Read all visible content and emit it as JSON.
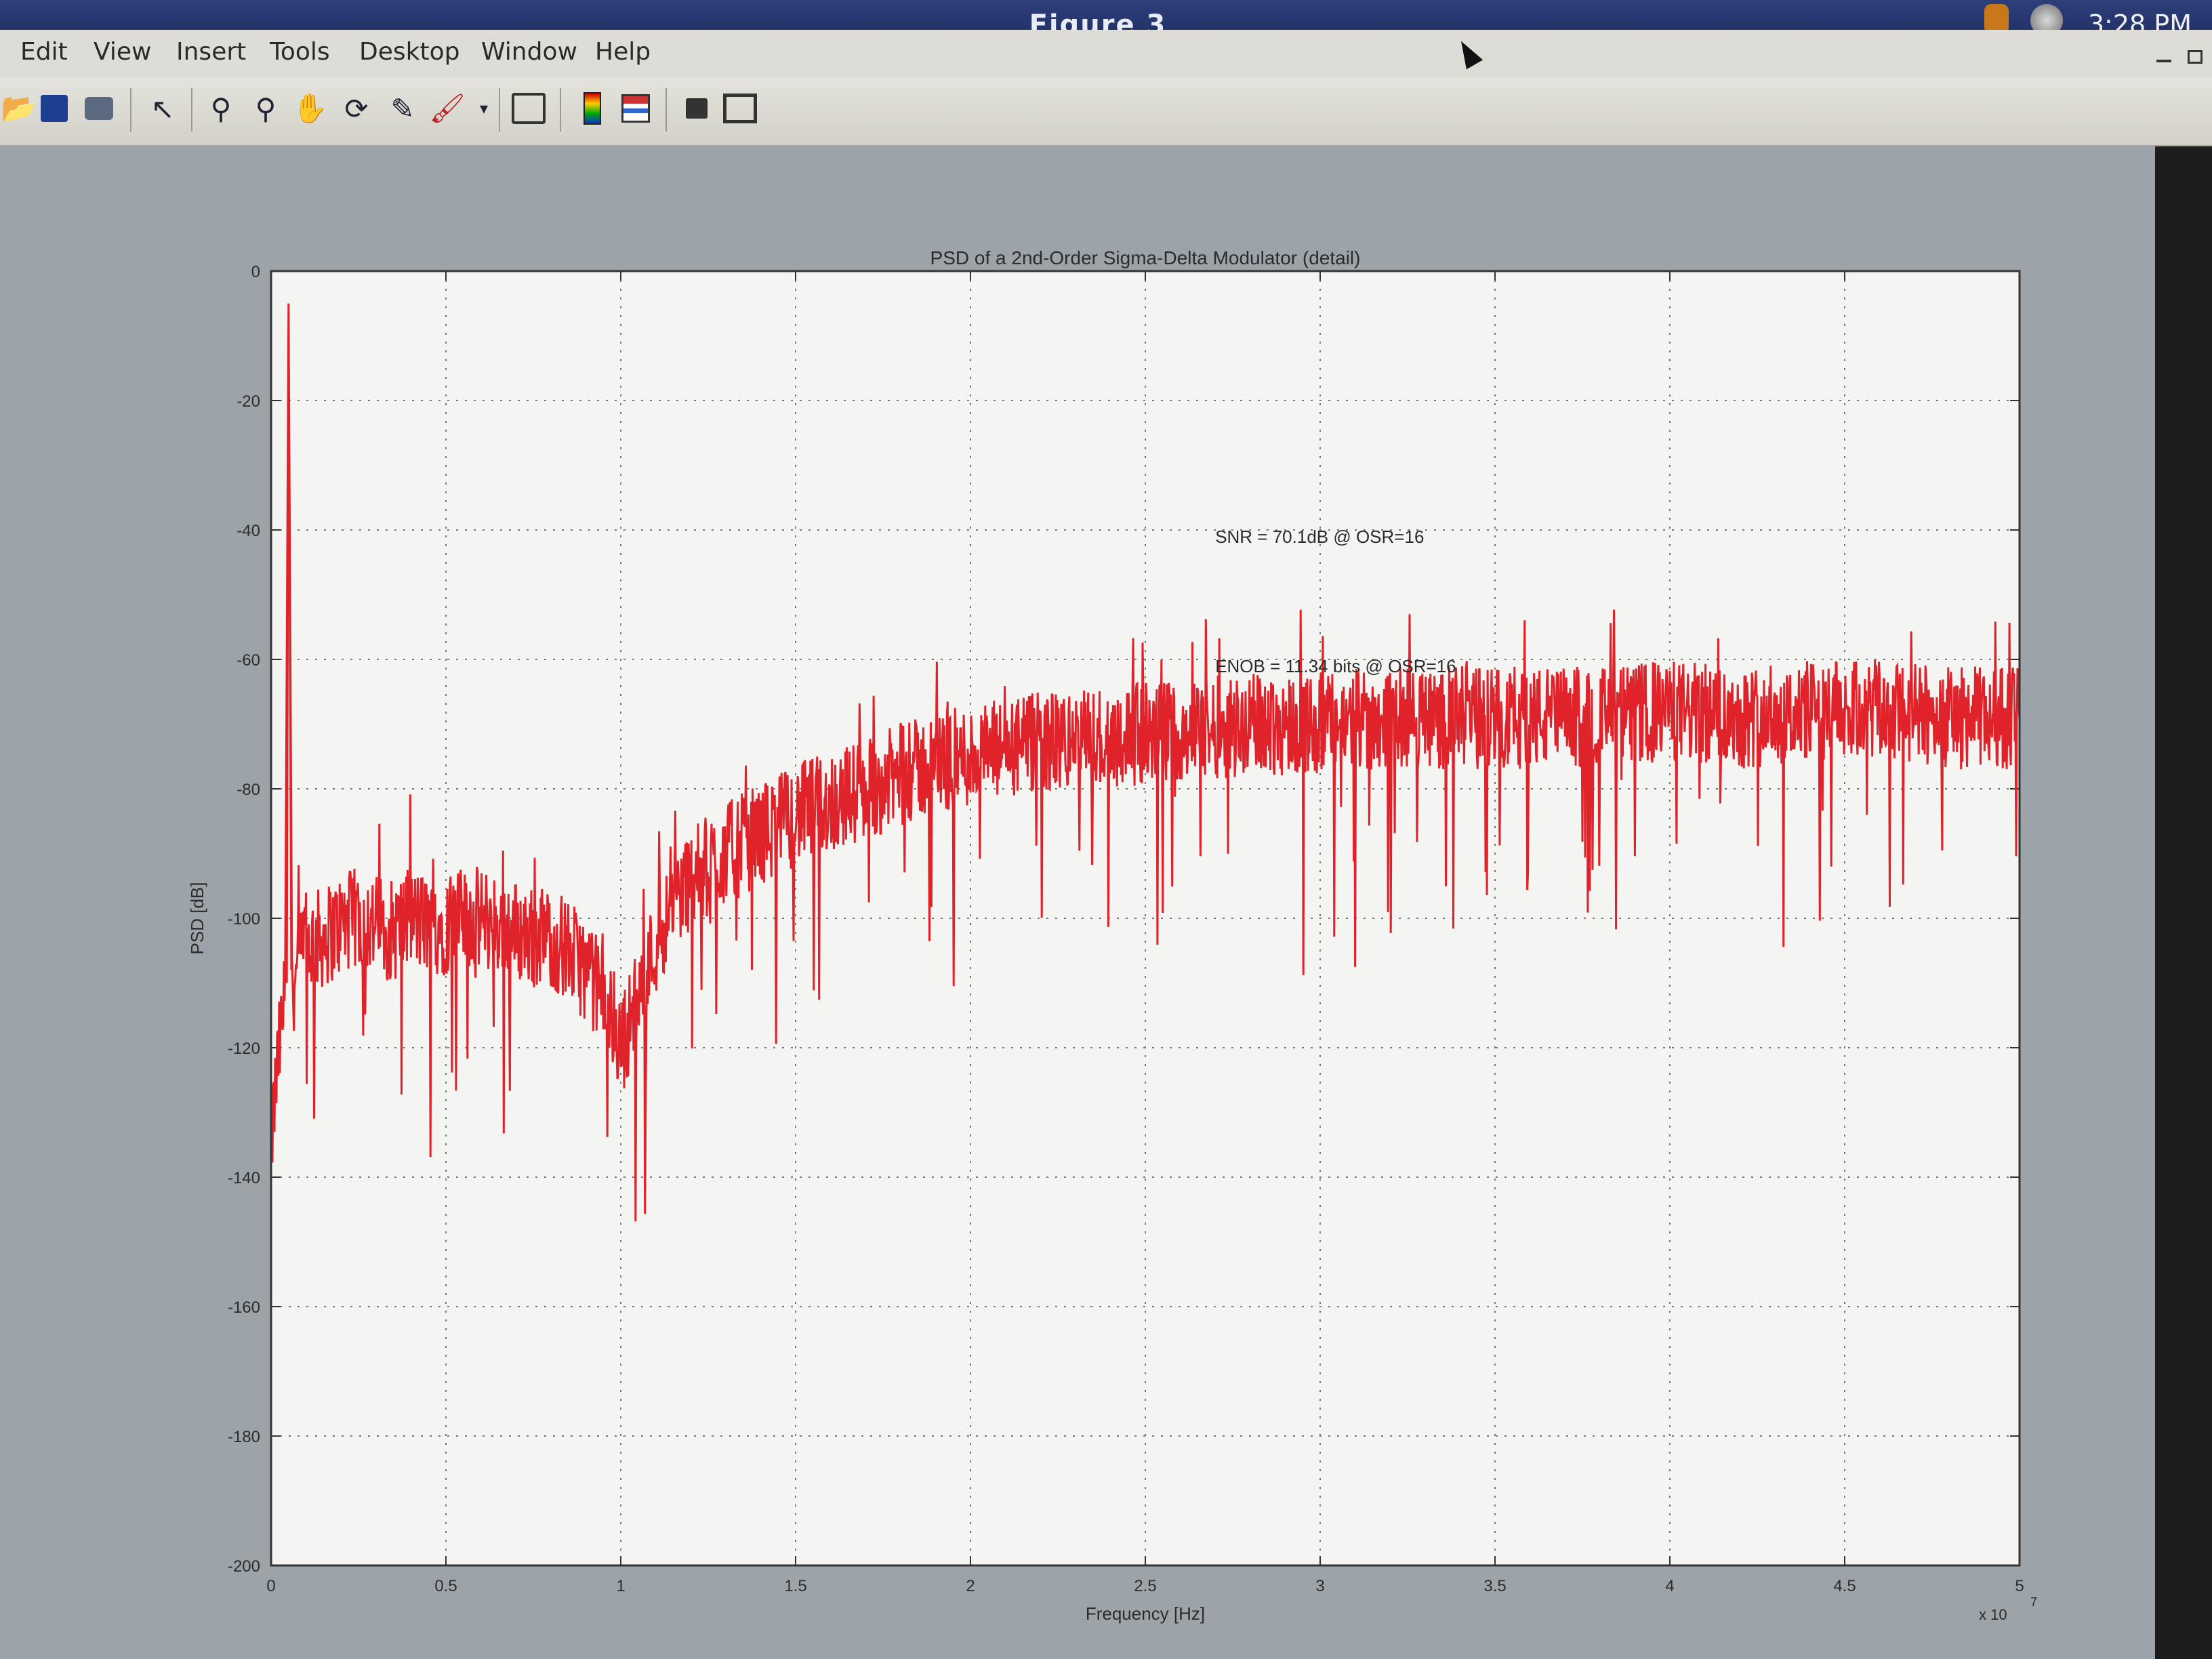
{
  "window": {
    "title": "Figure 3",
    "clock": "3:28 PM"
  },
  "menu": {
    "items": [
      "Edit",
      "View",
      "Insert",
      "Tools",
      "Desktop",
      "Window",
      "Help"
    ]
  },
  "toolbar": {
    "icons": [
      "open-file-icon",
      "save-icon",
      "print-icon",
      "pointer-icon",
      "zoom-in-icon",
      "zoom-out-icon",
      "pan-icon",
      "rotate-3d-icon",
      "data-cursor-icon",
      "brush-icon",
      "brush-dropdown-icon",
      "link-plot-icon",
      "colorbar-icon",
      "legend-icon",
      "hide-plot-tools-icon",
      "show-plot-tools-icon"
    ]
  },
  "chart_data": {
    "type": "line",
    "title": "PSD of a 2nd-Order Sigma-Delta Modulator (detail)",
    "xlabel": "Frequency [Hz]",
    "ylabel": "PSD [dB]",
    "x_exponent_label": "x 10",
    "x_exponent_power": "7",
    "xlim": [
      0,
      5
    ],
    "ylim": [
      -200,
      0
    ],
    "xticks": [
      "0",
      "0.5",
      "1",
      "1.5",
      "2",
      "2.5",
      "3",
      "3.5",
      "4",
      "4.5",
      "5"
    ],
    "yticks": [
      "0",
      "-20",
      "-40",
      "-60",
      "-80",
      "-100",
      "-120",
      "-140",
      "-160",
      "-180",
      "-200"
    ],
    "grid": true,
    "line_color": "#e0232a",
    "annotations": [
      {
        "text": "SNR = 70.1dB @ OSR=16",
        "x": 2.7,
        "y": -42
      },
      {
        "text": "ENOB = 11.34 bits @ OSR=16",
        "x": 2.7,
        "y": -62
      }
    ],
    "series": [
      {
        "x": [
          0,
          0.02,
          0.04,
          0.05,
          0.06,
          0.08,
          0.1,
          0.15,
          0.2,
          0.25,
          0.3,
          0.35,
          0.4,
          0.45,
          0.5,
          0.55,
          0.6,
          0.65,
          0.7,
          0.75,
          0.8,
          0.85,
          0.9,
          0.95,
          1.0,
          1.05,
          1.1,
          1.15,
          1.2,
          1.3,
          1.4,
          1.5,
          1.6,
          1.7,
          1.8,
          1.9,
          2.0,
          2.2,
          2.4,
          2.6,
          2.8,
          3.0,
          3.2,
          3.4,
          3.6,
          3.8,
          4.0,
          4.2,
          4.4,
          4.6,
          4.8,
          5.0
        ],
        "y": [
          -135,
          -122,
          -112,
          -5,
          -110,
          -108,
          -104,
          -103,
          -101,
          -100,
          -101,
          -102,
          -100,
          -101,
          -101,
          -100,
          -100,
          -101,
          -102,
          -103,
          -103,
          -105,
          -108,
          -112,
          -120,
          -112,
          -104,
          -97,
          -94,
          -90,
          -87,
          -84,
          -82,
          -80,
          -78,
          -76,
          -75,
          -73,
          -72,
          -71,
          -70,
          -70,
          -69,
          -69,
          -69,
          -69,
          -68,
          -69,
          -68,
          -68,
          -69,
          -69
        ]
      }
    ]
  }
}
